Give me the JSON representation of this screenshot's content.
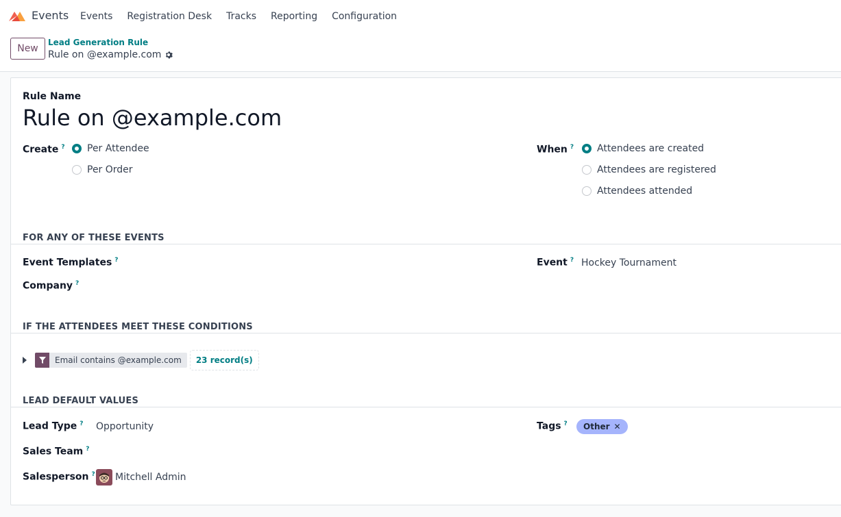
{
  "navbar": {
    "app_name": "Events",
    "menu": [
      "Events",
      "Registration Desk",
      "Tracks",
      "Reporting",
      "Configuration"
    ]
  },
  "control_panel": {
    "new_label": "New",
    "breadcrumb_parent": "Lead Generation Rule",
    "breadcrumb_current": "Rule on @example.com"
  },
  "form": {
    "name_label": "Rule Name",
    "name_value": "Rule on @example.com",
    "create_label": "Create",
    "create_options": [
      "Per Attendee",
      "Per Order"
    ],
    "create_selected": "Per Attendee",
    "when_label": "When",
    "when_options": [
      "Attendees are created",
      "Attendees are registered",
      "Attendees attended"
    ],
    "when_selected": "Attendees are created",
    "section_events": "FOR ANY OF THESE EVENTS",
    "event_templates_label": "Event Templates",
    "company_label": "Company",
    "event_label": "Event",
    "event_value": "Hockey Tournament",
    "section_conditions": "IF THE ATTENDEES MEET THESE CONDITIONS",
    "filter_text": "Email contains @example.com",
    "records_text": "23 record(s)",
    "section_defaults": "LEAD DEFAULT VALUES",
    "lead_type_label": "Lead Type",
    "lead_type_value": "Opportunity",
    "sales_team_label": "Sales Team",
    "salesperson_label": "Salesperson",
    "salesperson_value": "Mitchell Admin",
    "tags_label": "Tags",
    "tag_value": "Other",
    "help_mark": "?"
  },
  "colors": {
    "primary": "#714b67",
    "accent": "#017e84",
    "tag": "#a5b4fc"
  },
  "icons": [
    "app-logo-icon",
    "gear-icon",
    "filter-icon",
    "caret-right-icon",
    "close-icon"
  ]
}
